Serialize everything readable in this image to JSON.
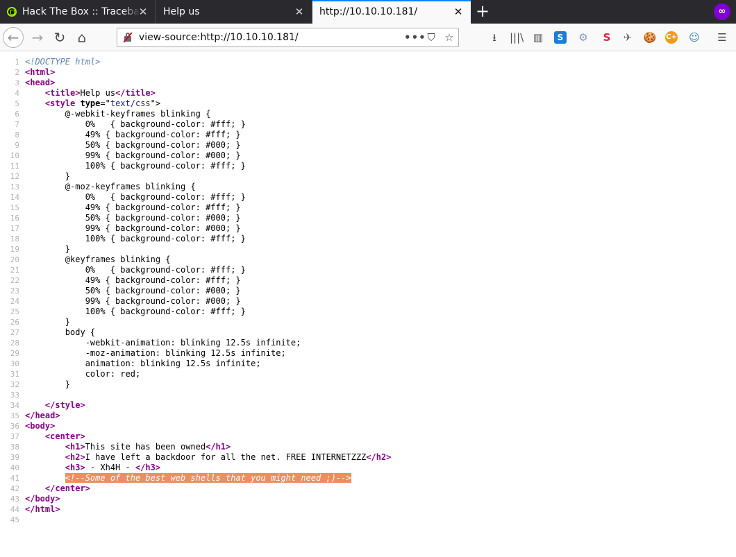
{
  "tabs": [
    {
      "label": "Hack The Box :: Traceback",
      "close": "✕"
    },
    {
      "label": "Help us",
      "close": "✕"
    },
    {
      "label": "http://10.10.10.181/",
      "close": "✕"
    }
  ],
  "newtab_symbol": "+",
  "private_symbol": "∞",
  "nav": {
    "back": "←",
    "forward": "→",
    "reload": "↻",
    "home": "⌂"
  },
  "url": "view-source:http://10.10.10.181/",
  "url_actions": {
    "page_actions": "•••",
    "pocket": "⛉",
    "bookmark": "☆"
  },
  "toolbar": {
    "downloads": "⭳",
    "library": "|||\\",
    "sidebar": "▥",
    "ext1": "S",
    "ext2": "⚙",
    "ext3": "S",
    "ext4": "✈",
    "ext5": "🍪",
    "ext6": "C+",
    "ext7": "☺",
    "menu": "☰"
  },
  "icons": {
    "insecure": "insecure-lock-icon",
    "htb": "hackthebox-favicon",
    "private": "private-browsing-icon"
  },
  "colors": {
    "tab_strip": "#2a2a2e",
    "active_tab_accent": "#0a84ff",
    "tag": "#880088",
    "attr_value": "#1a1aa6",
    "comment_highlight": "#ee8e5f",
    "line_number": "#b3b3b3"
  },
  "source_lines": [
    {
      "n": "1",
      "parts": [
        [
          "dt",
          "<!DOCTYPE html>"
        ]
      ]
    },
    {
      "n": "2",
      "parts": [
        [
          "t",
          "<html>"
        ]
      ]
    },
    {
      "n": "3",
      "parts": [
        [
          "t",
          "<head>"
        ]
      ]
    },
    {
      "n": "4",
      "parts": [
        [
          "p",
          "    "
        ],
        [
          "t",
          "<title>"
        ],
        [
          "p",
          "Help us"
        ],
        [
          "t",
          "</title>"
        ]
      ]
    },
    {
      "n": "5",
      "parts": [
        [
          "p",
          "    "
        ],
        [
          "t",
          "<style "
        ],
        [
          "a",
          "type"
        ],
        [
          "p",
          "=\""
        ],
        [
          "v",
          "text/css"
        ],
        [
          "p",
          "\">"
        ]
      ]
    },
    {
      "n": "6",
      "parts": [
        [
          "p",
          "        @-webkit-keyframes blinking {"
        ]
      ]
    },
    {
      "n": "7",
      "parts": [
        [
          "p",
          "            0%   { background-color: #fff; }"
        ]
      ]
    },
    {
      "n": "8",
      "parts": [
        [
          "p",
          "            49% { background-color: #fff; }"
        ]
      ]
    },
    {
      "n": "9",
      "parts": [
        [
          "p",
          "            50% { background-color: #000; }"
        ]
      ]
    },
    {
      "n": "10",
      "parts": [
        [
          "p",
          "            99% { background-color: #000; }"
        ]
      ]
    },
    {
      "n": "11",
      "parts": [
        [
          "p",
          "            100% { background-color: #fff; }"
        ]
      ]
    },
    {
      "n": "12",
      "parts": [
        [
          "p",
          "        }"
        ]
      ]
    },
    {
      "n": "13",
      "parts": [
        [
          "p",
          "        @-moz-keyframes blinking {"
        ]
      ]
    },
    {
      "n": "14",
      "parts": [
        [
          "p",
          "            0%   { background-color: #fff; }"
        ]
      ]
    },
    {
      "n": "15",
      "parts": [
        [
          "p",
          "            49% { background-color: #fff; }"
        ]
      ]
    },
    {
      "n": "16",
      "parts": [
        [
          "p",
          "            50% { background-color: #000; }"
        ]
      ]
    },
    {
      "n": "17",
      "parts": [
        [
          "p",
          "            99% { background-color: #000; }"
        ]
      ]
    },
    {
      "n": "18",
      "parts": [
        [
          "p",
          "            100% { background-color: #fff; }"
        ]
      ]
    },
    {
      "n": "19",
      "parts": [
        [
          "p",
          "        }"
        ]
      ]
    },
    {
      "n": "20",
      "parts": [
        [
          "p",
          "        @keyframes blinking {"
        ]
      ]
    },
    {
      "n": "21",
      "parts": [
        [
          "p",
          "            0%   { background-color: #fff; }"
        ]
      ]
    },
    {
      "n": "22",
      "parts": [
        [
          "p",
          "            49% { background-color: #fff; }"
        ]
      ]
    },
    {
      "n": "23",
      "parts": [
        [
          "p",
          "            50% { background-color: #000; }"
        ]
      ]
    },
    {
      "n": "24",
      "parts": [
        [
          "p",
          "            99% { background-color: #000; }"
        ]
      ]
    },
    {
      "n": "25",
      "parts": [
        [
          "p",
          "            100% { background-color: #fff; }"
        ]
      ]
    },
    {
      "n": "26",
      "parts": [
        [
          "p",
          "        }"
        ]
      ]
    },
    {
      "n": "27",
      "parts": [
        [
          "p",
          "        body {"
        ]
      ]
    },
    {
      "n": "28",
      "parts": [
        [
          "p",
          "            -webkit-animation: blinking 12.5s infinite;"
        ]
      ]
    },
    {
      "n": "29",
      "parts": [
        [
          "p",
          "            -moz-animation: blinking 12.5s infinite;"
        ]
      ]
    },
    {
      "n": "30",
      "parts": [
        [
          "p",
          "            animation: blinking 12.5s infinite;"
        ]
      ]
    },
    {
      "n": "31",
      "parts": [
        [
          "p",
          "            color: red;"
        ]
      ]
    },
    {
      "n": "32",
      "parts": [
        [
          "p",
          "        }"
        ]
      ]
    },
    {
      "n": "33",
      "parts": []
    },
    {
      "n": "34",
      "parts": [
        [
          "p",
          "    "
        ],
        [
          "t",
          "</style>"
        ]
      ]
    },
    {
      "n": "35",
      "parts": [
        [
          "t",
          "</head>"
        ]
      ]
    },
    {
      "n": "36",
      "parts": [
        [
          "t",
          "<body>"
        ]
      ]
    },
    {
      "n": "37",
      "parts": [
        [
          "p",
          "    "
        ],
        [
          "t",
          "<center>"
        ]
      ]
    },
    {
      "n": "38",
      "parts": [
        [
          "p",
          "        "
        ],
        [
          "t",
          "<h1>"
        ],
        [
          "p",
          "This site has been owned"
        ],
        [
          "t",
          "</h1>"
        ]
      ]
    },
    {
      "n": "39",
      "parts": [
        [
          "p",
          "        "
        ],
        [
          "t",
          "<h2>"
        ],
        [
          "p",
          "I have left a backdoor for all the net. FREE INTERNETZZZ"
        ],
        [
          "t",
          "</h2>"
        ]
      ]
    },
    {
      "n": "40",
      "parts": [
        [
          "p",
          "        "
        ],
        [
          "t",
          "<h3>"
        ],
        [
          "p",
          " - Xh4H - "
        ],
        [
          "t",
          "</h3>"
        ]
      ]
    },
    {
      "n": "41",
      "parts": [
        [
          "p",
          "        "
        ],
        [
          "cm",
          "<!--Some of the best web shells that you might need ;)-->"
        ]
      ]
    },
    {
      "n": "42",
      "parts": [
        [
          "p",
          "    "
        ],
        [
          "t",
          "</center>"
        ]
      ]
    },
    {
      "n": "43",
      "parts": [
        [
          "t",
          "</body>"
        ]
      ]
    },
    {
      "n": "44",
      "parts": [
        [
          "t",
          "</html>"
        ]
      ]
    },
    {
      "n": "45",
      "parts": []
    }
  ]
}
